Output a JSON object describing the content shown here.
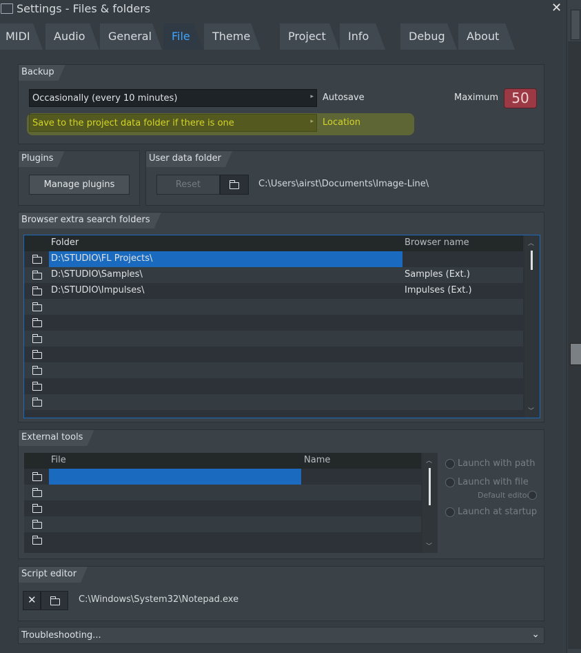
{
  "window": {
    "title": "Settings - Files & folders"
  },
  "tabs": [
    {
      "label": "MIDI"
    },
    {
      "label": "Audio"
    },
    {
      "label": "General"
    },
    {
      "label": "File"
    },
    {
      "label": "Theme"
    },
    {
      "label": "Project"
    },
    {
      "label": "Info"
    },
    {
      "label": "Debug"
    },
    {
      "label": "About"
    }
  ],
  "active_tab": "File",
  "colors": {
    "accent": "#3fa4ff",
    "selection": "#1a6bbf",
    "highlight_text": "#e8e530",
    "max_box": "#9b3a44"
  },
  "backup": {
    "title": "Backup",
    "autosave_value": "Occasionally (every 10 minutes)",
    "autosave_label": "Autosave",
    "location_value": "Save to the project data folder if there is one",
    "location_label": "Location",
    "maximum_label": "Maximum",
    "maximum_value": "50"
  },
  "plugins": {
    "title": "Plugins",
    "manage_label": "Manage plugins"
  },
  "user_data": {
    "title": "User data folder",
    "reset_label": "Reset",
    "path": "C:\\Users\\airst\\Documents\\Image-Line\\"
  },
  "browser_folders": {
    "title": "Browser extra search folders",
    "columns": [
      "Folder",
      "Browser name"
    ],
    "rows": [
      {
        "folder": "D:\\STUDIO\\FL Projects\\",
        "name": ""
      },
      {
        "folder": "D:\\STUDIO\\Samples\\",
        "name": "Samples (Ext.)"
      },
      {
        "folder": "D:\\STUDIO\\Impulses\\",
        "name": "Impulses (Ext.)"
      },
      {
        "folder": "",
        "name": ""
      },
      {
        "folder": "",
        "name": ""
      },
      {
        "folder": "",
        "name": ""
      },
      {
        "folder": "",
        "name": ""
      },
      {
        "folder": "",
        "name": ""
      },
      {
        "folder": "",
        "name": ""
      },
      {
        "folder": "",
        "name": ""
      }
    ]
  },
  "external_tools": {
    "title": "External tools",
    "columns": [
      "File",
      "Name"
    ],
    "rows": [
      {
        "file": "",
        "name": ""
      },
      {
        "file": "",
        "name": ""
      },
      {
        "file": "",
        "name": ""
      },
      {
        "file": "",
        "name": ""
      },
      {
        "file": "",
        "name": ""
      }
    ],
    "launch_with_path": "Launch with path",
    "launch_with_file": "Launch with file",
    "default_editor": "Default editor",
    "launch_at_startup": "Launch at startup"
  },
  "script_editor": {
    "title": "Script editor",
    "path": "C:\\Windows\\System32\\Notepad.exe"
  },
  "troubleshooting": {
    "label": "Troubleshooting..."
  }
}
